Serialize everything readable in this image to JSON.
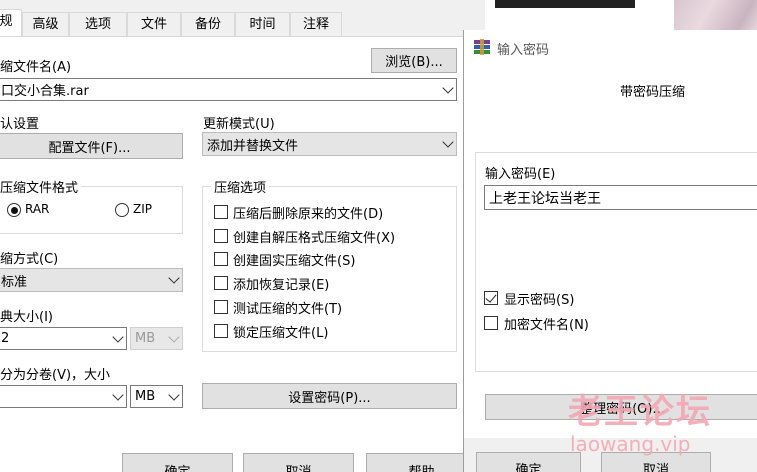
{
  "tabs": [
    "规",
    "高级",
    "选项",
    "文件",
    "备份",
    "时间",
    "注释"
  ],
  "archive_name": {
    "label": "缩文件名(A)",
    "value": "口交小合集.rar",
    "browse_button": "浏览(B)..."
  },
  "default_settings": {
    "label": "认设置",
    "profile_button": "配置文件(F)..."
  },
  "update_mode": {
    "label": "更新模式(U)",
    "value": "添加并替换文件"
  },
  "archive_format": {
    "label": "压缩文件格式",
    "options": [
      "RAR",
      "ZIP"
    ],
    "selected": "RAR"
  },
  "compression_options": {
    "label": "压缩选项",
    "items": [
      {
        "label": "压缩后删除原来的文件(D)",
        "checked": false
      },
      {
        "label": "创建自解压格式压缩文件(X)",
        "checked": false
      },
      {
        "label": "创建固实压缩文件(S)",
        "checked": false
      },
      {
        "label": "添加恢复记录(E)",
        "checked": false
      },
      {
        "label": "测试压缩的文件(T)",
        "checked": false
      },
      {
        "label": "锁定压缩文件(L)",
        "checked": false
      }
    ]
  },
  "compression_method": {
    "label": "缩方式(C)",
    "value": "标准"
  },
  "dictionary_size": {
    "label": "典大小(I)",
    "value": "2",
    "unit": "MB"
  },
  "split_volumes": {
    "label": "分为分卷(V)，大小",
    "value": "",
    "unit": "MB"
  },
  "set_password_button": "设置密码(P)...",
  "bottom_buttons": [
    "确定",
    "取消",
    "帮助"
  ],
  "password_dialog": {
    "title": "输入密码",
    "heading": "带密码压缩",
    "password_label": "输入密码(E)",
    "password_value": "上老王论坛当老王",
    "show_password": {
      "label": "显示密码(S)",
      "checked": true
    },
    "encrypt_filenames": {
      "label": "加密文件名(N)",
      "checked": false
    },
    "organize_button": "整理密码(O)...",
    "ok_button": "确定",
    "cancel_button": "取消"
  },
  "watermark": {
    "text_cn": "老王论坛",
    "text_en": "laowang.vip",
    "color": "#f4a7b4"
  }
}
